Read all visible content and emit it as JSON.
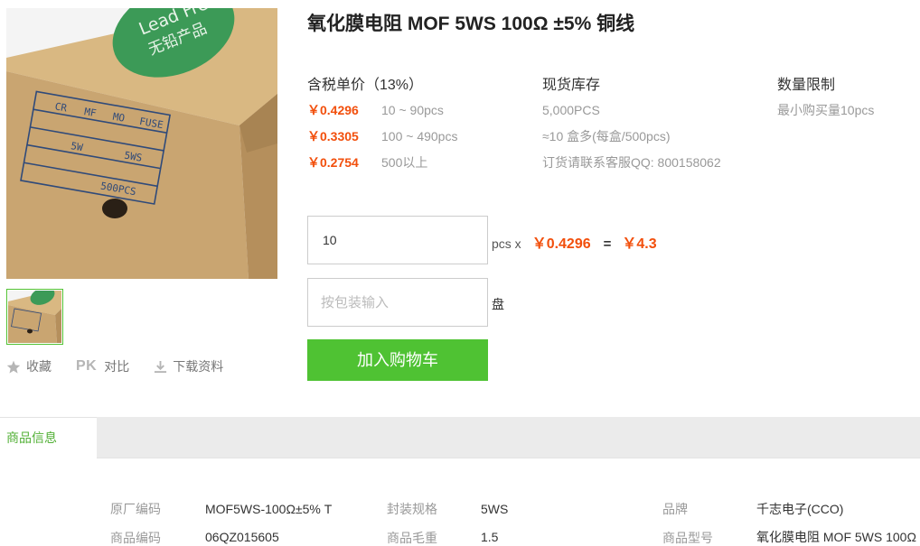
{
  "product": {
    "title": "氧化膜电阻 MOF 5WS 100Ω ±5% 铜线",
    "box_printed_text": {
      "sticker": "Lead Free",
      "sticker_cn": "无铅产品",
      "types": [
        "CR",
        "MF",
        "MO",
        "FUSE"
      ],
      "watt": "5W",
      "size": "5WS",
      "qty": "500PCS"
    }
  },
  "actions": {
    "favorite": "收藏",
    "pk_mark": "PK",
    "compare": "对比",
    "download": "下载资料"
  },
  "price": {
    "header": "含税单价（13%）",
    "tiers": [
      {
        "price": "￥0.4296",
        "qty": "10 ~ 90pcs"
      },
      {
        "price": "￥0.3305",
        "qty": "100 ~ 490pcs"
      },
      {
        "price": "￥0.2754",
        "qty": "500以上"
      }
    ]
  },
  "stock": {
    "header": "现货库存",
    "rows": [
      "5,000PCS",
      "≈10 盒多(每盒/500pcs)",
      "订货请联系客服QQ: 800158062"
    ]
  },
  "limit": {
    "header": "数量限制",
    "rows": [
      "最小购买量10pcs"
    ]
  },
  "order": {
    "quantity_value": "10",
    "unit": "pcs x",
    "unit_price": "￥0.4296",
    "equals": "=",
    "total": "￥4.3",
    "package_placeholder": "按包装输入",
    "package_unit": "盘",
    "cart_button": "加入购物车"
  },
  "tabs": [
    {
      "label": "商品信息",
      "active": true
    }
  ],
  "specs": [
    {
      "label": "原厂编码",
      "value": "MOF5WS-100Ω±5% T"
    },
    {
      "label": "封装规格",
      "value": "5WS"
    },
    {
      "label": "品牌",
      "value": "千志电子(CCO)"
    },
    {
      "label": "商品编码",
      "value": "06QZ015605"
    },
    {
      "label": "商品毛重",
      "value": "1.5"
    },
    {
      "label": "商品型号",
      "value": "氧化膜电阻 MOF 5WS 100Ω"
    }
  ],
  "colors": {
    "accent_green": "#4fc233",
    "price_orange": "#f24f0c",
    "muted_text": "#999999"
  }
}
